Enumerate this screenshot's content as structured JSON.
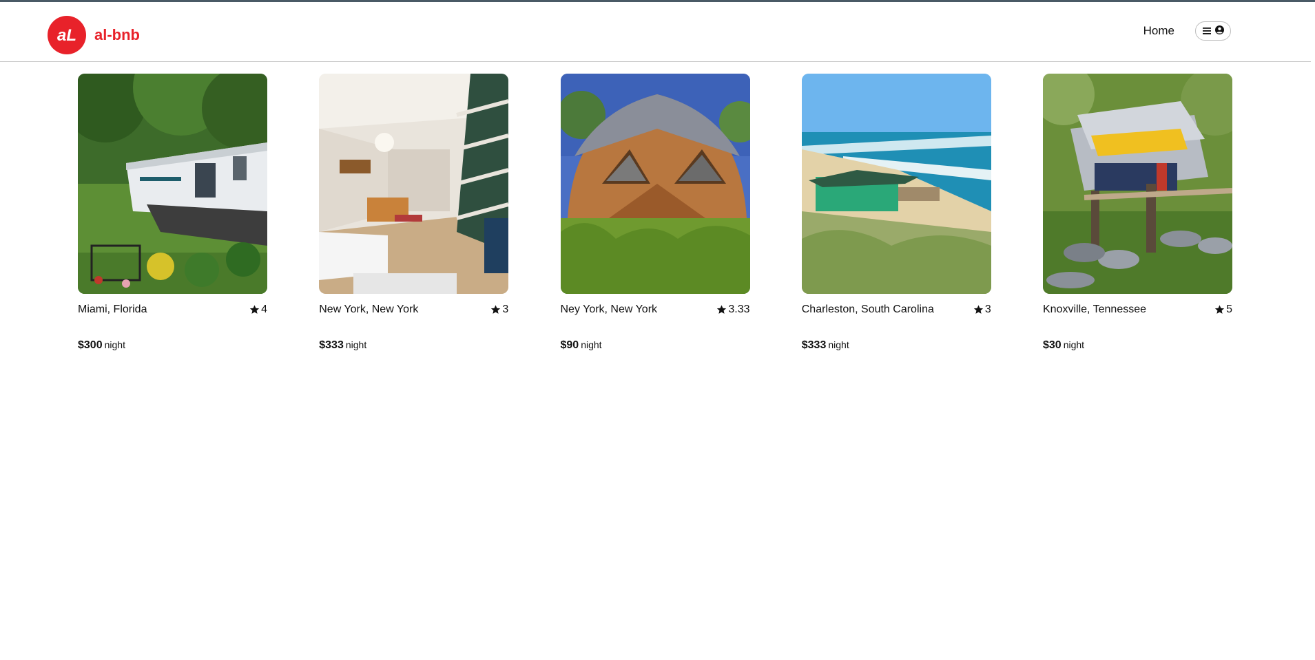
{
  "header": {
    "logo_text": "aL",
    "brand": "al-bnb",
    "home_link": "Home",
    "menu_icon": "hamburger-icon",
    "user_icon": "user-circle-icon"
  },
  "colors": {
    "brand": "#e8222a",
    "accent_line": "#4a5a66"
  },
  "listings": [
    {
      "location": "Miami, Florida",
      "rating": "4",
      "price": "$300",
      "unit": "night",
      "image": "mobile-home-garden"
    },
    {
      "location": "New York, New York",
      "rating": "3",
      "price": "$333",
      "unit": "night",
      "image": "loft-interior-staircase"
    },
    {
      "location": "Ney York, New York",
      "rating": "3.33",
      "price": "$90",
      "unit": "night",
      "image": "geodesic-dome-cabin"
    },
    {
      "location": "Charleston, South Carolina",
      "rating": "3",
      "price": "$333",
      "unit": "night",
      "image": "beach-house-dunes"
    },
    {
      "location": "Knoxville, Tennessee",
      "rating": "5",
      "price": "$30",
      "unit": "night",
      "image": "truck-treehouse"
    }
  ]
}
